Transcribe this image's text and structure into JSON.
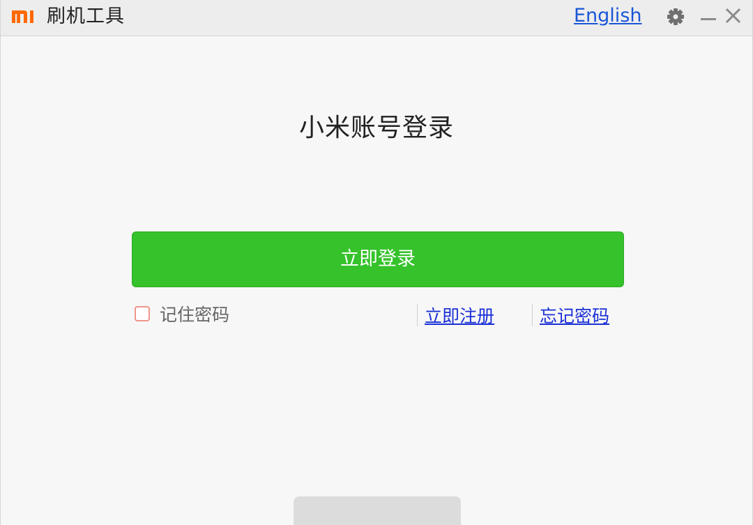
{
  "titlebar": {
    "logo_text": "MI",
    "app_title": "刷机工具",
    "language_link": "English",
    "icons": [
      "gear-icon",
      "minimize-icon",
      "close-icon"
    ]
  },
  "login": {
    "heading": "小米账号登录",
    "login_button": "立即登录",
    "remember_password": "记住密码",
    "remember_checked": false,
    "register_link": "立即注册",
    "forgot_link": "忘记密码"
  },
  "colors": {
    "brand_orange": "#ff6900",
    "login_green": "#35c22b",
    "link_blue": "#1a2fd6",
    "checkbox_border": "#f0958a"
  }
}
